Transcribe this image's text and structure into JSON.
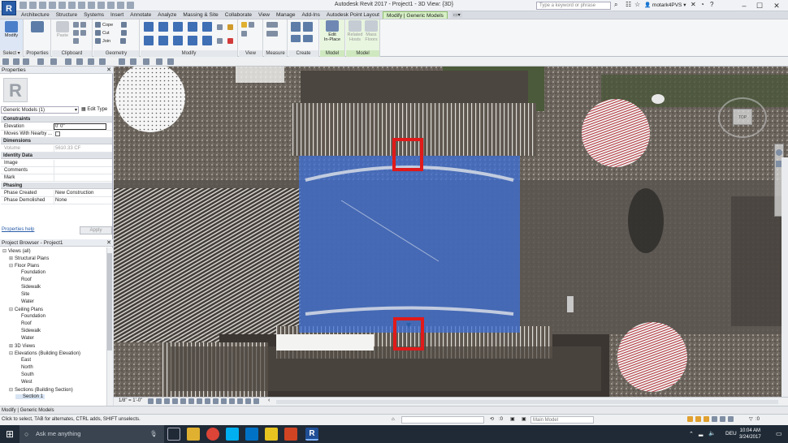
{
  "window": {
    "app_button": "R",
    "title": "Autodesk Revit 2017 -    Project1 - 3D View: {3D}",
    "search_placeholder": "Type a keyword or phrase",
    "user": "motark4PVS"
  },
  "ribbon": {
    "tabs": [
      "Architecture",
      "Structure",
      "Systems",
      "Insert",
      "Annotate",
      "Analyze",
      "Massing & Site",
      "Collaborate",
      "View",
      "Manage",
      "Add-Ins",
      "Autodesk Point Layout",
      "Modify | Generic Models"
    ],
    "active_tab": "Modify | Generic Models",
    "select": {
      "button": "Modify",
      "panel": "Select"
    },
    "properties": {
      "panel": "Properties"
    },
    "clipboard": {
      "paste": "Paste",
      "panel": "Clipboard"
    },
    "geometry": {
      "cope": "Cope",
      "cut": "Cut",
      "join": "Join",
      "panel": "Geometry"
    },
    "modify": {
      "panel": "Modify"
    },
    "view": {
      "panel": "View"
    },
    "measure": {
      "panel": "Measure"
    },
    "create": {
      "panel": "Create"
    },
    "model1": {
      "edit_in_place_line1": "Edit",
      "edit_in_place_line2": "In-Place",
      "panel": "Model"
    },
    "model2": {
      "related_hosts_line1": "Related",
      "related_hosts_line2": "Hosts",
      "mass_floors_line1": "Mass",
      "mass_floors_line2": "Floors",
      "panel": "Model"
    }
  },
  "properties_palette": {
    "title": "Properties",
    "type_selector": "Generic Models (1)",
    "edit_type": "Edit Type",
    "groups": {
      "constraints": "Constraints",
      "dimensions": "Dimensions",
      "identity": "Identity Data",
      "phasing": "Phasing"
    },
    "rows": {
      "elevation_label": "Elevation",
      "elevation_value": "0' 0\"",
      "moves_label": "Moves With Nearby ...",
      "volume_label": "Volume",
      "volume_value": "5610.33 CF",
      "image_label": "Image",
      "comments_label": "Comments",
      "mark_label": "Mark",
      "phase_created_label": "Phase Created",
      "phase_created_value": "New Construction",
      "phase_demolished_label": "Phase Demolished",
      "phase_demolished_value": "None"
    },
    "help_link": "Properties help",
    "apply": "Apply"
  },
  "project_browser": {
    "title": "Project Browser - Project1",
    "items": [
      {
        "label": "Views (all)",
        "toggle": "⊟"
      },
      {
        "label": "Structural Plans",
        "toggle": "⊞"
      },
      {
        "label": "Floor Plans",
        "toggle": "⊟"
      },
      {
        "label": "Foundation",
        "toggle": ""
      },
      {
        "label": "Roof",
        "toggle": ""
      },
      {
        "label": "Sidewalk",
        "toggle": ""
      },
      {
        "label": "Site",
        "toggle": ""
      },
      {
        "label": "Water",
        "toggle": ""
      },
      {
        "label": "Ceiling Plans",
        "toggle": "⊟"
      },
      {
        "label": "Foundation",
        "toggle": ""
      },
      {
        "label": "Roof",
        "toggle": ""
      },
      {
        "label": "Sidewalk",
        "toggle": ""
      },
      {
        "label": "Water",
        "toggle": ""
      },
      {
        "label": "3D Views",
        "toggle": "⊞"
      },
      {
        "label": "Elevations (Building Elevation)",
        "toggle": "⊟"
      },
      {
        "label": "East",
        "toggle": ""
      },
      {
        "label": "North",
        "toggle": ""
      },
      {
        "label": "South",
        "toggle": ""
      },
      {
        "label": "West",
        "toggle": ""
      },
      {
        "label": "Sections (Building Section)",
        "toggle": "⊟"
      },
      {
        "label": "Section 1",
        "toggle": ""
      }
    ]
  },
  "view_control_bar": {
    "scale": "1/8\" = 1'-0\""
  },
  "navigation": {
    "viewcube_label": "TOP"
  },
  "status": {
    "context": "Modify | Generic Models",
    "hint": "Click to select, TAB for alternates, CTRL adds, SHIFT unselects.",
    "coord": ":0",
    "workset": "Main Model",
    "filter": ":0"
  },
  "taskbar": {
    "search_placeholder": "Ask me anything",
    "language": "DEU",
    "time": "10:04 AM",
    "date": "3/24/2017"
  },
  "colors": {
    "accent": "#2a5da8",
    "context_tab": "#d6f0c5",
    "highlight_box": "#e01a1a",
    "selected_model": "#3d6fd6"
  }
}
